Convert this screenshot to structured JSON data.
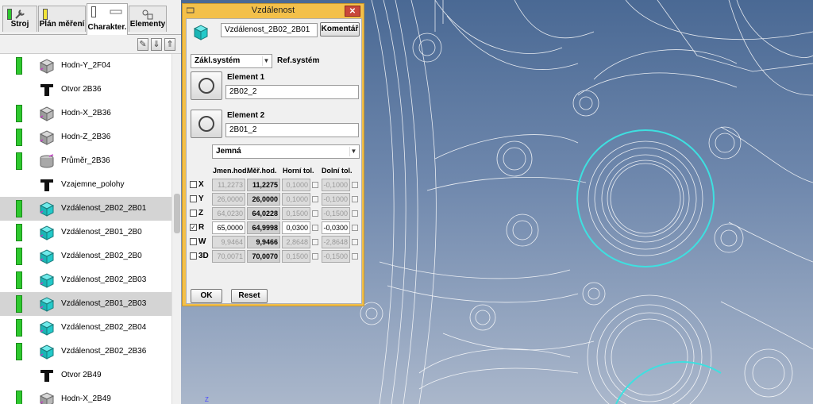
{
  "tabs": [
    {
      "label": "Stroj",
      "icon": "wrench-icon",
      "swatch": "#2ec82e"
    },
    {
      "label": "Plán měření",
      "swatch": "#f3e53a"
    },
    {
      "label": "Charakter.",
      "active": true,
      "swatch": "#ffffff"
    },
    {
      "label": "Elementy",
      "icon": "elements-icon"
    }
  ],
  "toolbar": {
    "edit": "✎",
    "down": "⇓",
    "up": "⇑"
  },
  "list": [
    {
      "label": "Hodn-Y_2F04",
      "bar": true,
      "icon": "gray-box-icon"
    },
    {
      "label": "Otvor 2B36",
      "bar": false,
      "icon": "t-icon"
    },
    {
      "label": "Hodn-X_2B36",
      "bar": true,
      "icon": "gray-box-icon"
    },
    {
      "label": "Hodn-Z_2B36",
      "bar": true,
      "icon": "gray-box-icon"
    },
    {
      "label": "Průměr_2B36",
      "bar": true,
      "icon": "cylinder-icon"
    },
    {
      "label": "Vzajemne_polohy",
      "bar": false,
      "icon": "t-icon"
    },
    {
      "label": "Vzdálenost_2B02_2B01",
      "bar": true,
      "icon": "cyan-box-icon",
      "selected": true
    },
    {
      "label": "Vzdálenost_2B01_2B0",
      "bar": true,
      "icon": "cyan-box-icon"
    },
    {
      "label": "Vzdálenost_2B02_2B0",
      "bar": true,
      "icon": "cyan-box-icon"
    },
    {
      "label": "Vzdálenost_2B02_2B03",
      "bar": true,
      "icon": "cyan-box-icon"
    },
    {
      "label": "Vzdálenost_2B01_2B03",
      "bar": true,
      "icon": "cyan-box-icon",
      "selected": true
    },
    {
      "label": "Vzdálenost_2B02_2B04",
      "bar": true,
      "icon": "cyan-box-icon"
    },
    {
      "label": "Vzdálenost_2B02_2B36",
      "bar": true,
      "icon": "cyan-box-icon"
    },
    {
      "label": "Otvor 2B49",
      "bar": false,
      "icon": "t-icon"
    },
    {
      "label": "Hodn-X_2B49",
      "bar": true,
      "icon": "gray-box-icon"
    }
  ],
  "dialog": {
    "title": "Vzdálenost",
    "close": "✕",
    "name_value": "Vzdálenost_2B02_2B01",
    "comment_button": "Komentář",
    "ref_select": "Zákl.systém",
    "ref_label": "Ref.systém",
    "element1_label": "Element 1",
    "element1_value": "2B02_2",
    "element2_label": "Element 2",
    "element2_value": "2B01_2",
    "precision_select": "Jemná",
    "headers": {
      "nominal": "Jmen.hod.",
      "measured": "Měř.hod.",
      "upper": "Horní tol.",
      "lower": "Dolní tol."
    },
    "rows": [
      {
        "axis": "X",
        "checked": false,
        "nominal": "11,2273",
        "measured": "11,2275",
        "upper": "0,1000",
        "lower": "-0,1000"
      },
      {
        "axis": "Y",
        "checked": false,
        "nominal": "26,0000",
        "measured": "26,0000",
        "upper": "0,1000",
        "lower": "-0,1000"
      },
      {
        "axis": "Z",
        "checked": false,
        "nominal": "64,0230",
        "measured": "64,0228",
        "upper": "0,1500",
        "lower": "-0,1500"
      },
      {
        "axis": "R",
        "checked": true,
        "nominal": "65,0000",
        "measured": "64,9998",
        "upper": "0,0300",
        "lower": "-0,0300"
      },
      {
        "axis": "W",
        "checked": false,
        "nominal": "9,9464",
        "measured": "9,9466",
        "upper": "2,8648",
        "lower": "-2,8648"
      },
      {
        "axis": "3D",
        "checked": false,
        "nominal": "70,0071",
        "measured": "70,0070",
        "upper": "0,1500",
        "lower": "-0,1500"
      }
    ],
    "ok_button": "OK",
    "reset_button": "Reset"
  },
  "viewport": {
    "axis_label": "Z",
    "highlight_color": "#3ee0e0"
  }
}
